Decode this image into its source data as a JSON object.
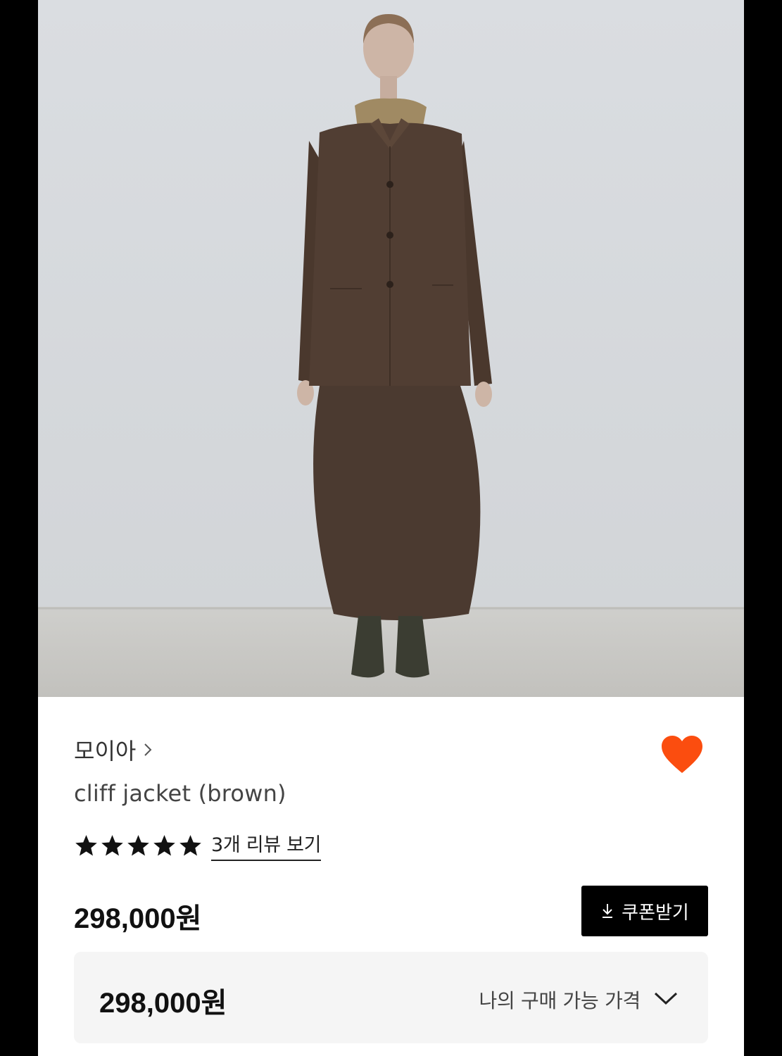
{
  "product": {
    "brand": "모이아",
    "name": "cliff jacket (brown)",
    "rating": {
      "stars": 5,
      "max": 5,
      "review_link": "3개 리뷰 보기"
    },
    "price": "298,000원"
  },
  "coupon_button": {
    "label": "쿠폰받기",
    "icon": "download-icon"
  },
  "price_box": {
    "value": "298,000원",
    "label": "나의 구매 가능 가격",
    "icon": "chevron-down-icon"
  },
  "colors": {
    "wishlist_heart": "#fb4d0f",
    "coupon_button_bg": "#000000",
    "price_box_bg": "#f5f5f5",
    "wall": "#d8dbde",
    "floor": "#c7c7c4",
    "garment": "#4e3c31"
  },
  "icons": [
    "chevron-right-icon",
    "heart-icon",
    "star-icon",
    "download-icon",
    "chevron-down-icon"
  ]
}
